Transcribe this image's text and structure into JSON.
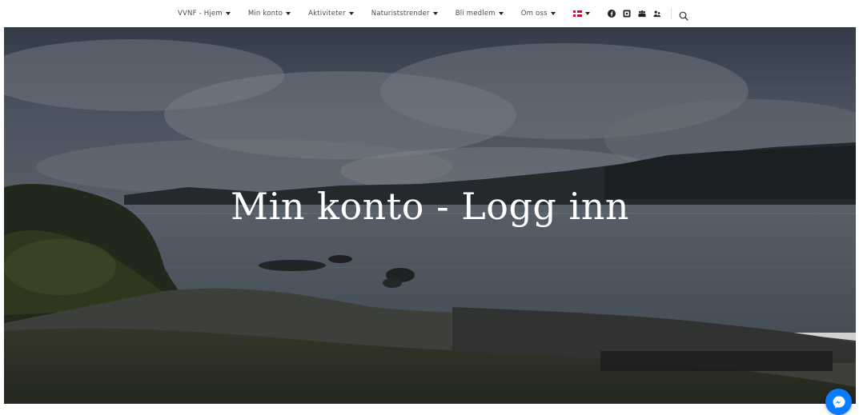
{
  "nav": {
    "items": [
      {
        "label": "VVNF - Hjem"
      },
      {
        "label": "Min konto"
      },
      {
        "label": "Aktiviteter"
      },
      {
        "label": "Naturiststrender"
      },
      {
        "label": "Bli medlem"
      },
      {
        "label": "Om oss"
      }
    ],
    "language_flag": "norwegian-flag-icon",
    "social_icons": [
      "facebook-icon",
      "instagram-icon",
      "group-icon",
      "users-icon"
    ],
    "search_icon": "search-icon"
  },
  "hero": {
    "title": "Min konto - Logg inn"
  },
  "messenger_icon": "messenger-icon",
  "colors": {
    "nav_text": "#4a4a4a",
    "hero_title": "#ffffff",
    "messenger": "#0a7cff"
  }
}
